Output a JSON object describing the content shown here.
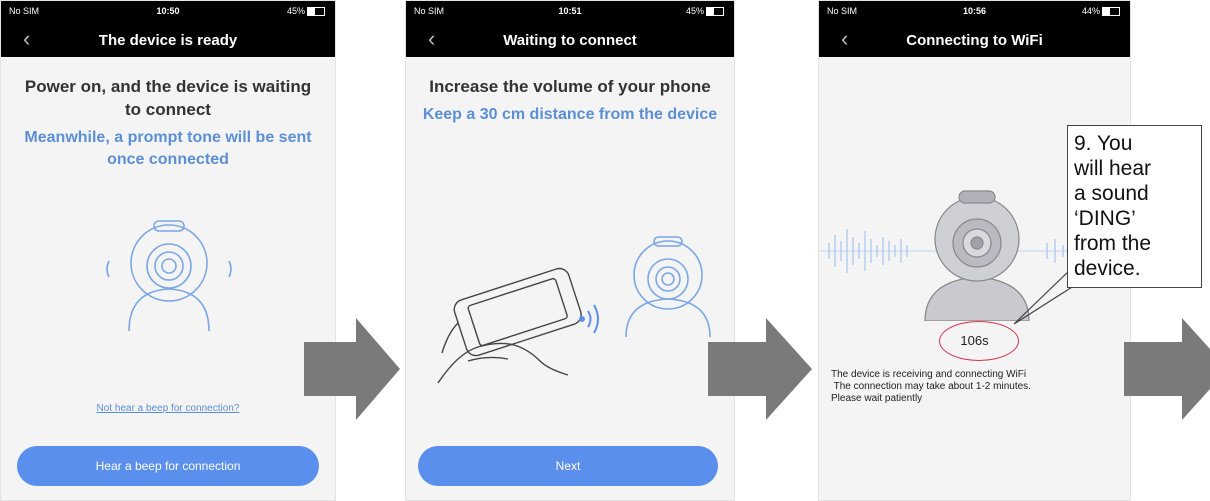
{
  "screens": [
    {
      "status": {
        "carrier": "No SIM",
        "time": "10:50",
        "battery": "45%"
      },
      "back": "‹",
      "title": "The device is ready",
      "heading": "Power on, and the device is waiting to connect",
      "subheading": "Meanwhile, a prompt tone will be sent once connected",
      "help_link": "Not hear a beep for connection?",
      "button": "Hear a beep for connection"
    },
    {
      "status": {
        "carrier": "No SIM",
        "time": "10:51",
        "battery": "45%"
      },
      "back": "‹",
      "title": "Waiting to connect",
      "heading": "Increase the volume of your phone",
      "subheading": "Keep a 30 cm distance from the device",
      "button": "Next"
    },
    {
      "status": {
        "carrier": "No SIM",
        "time": "10:56",
        "battery": "44%"
      },
      "back": "‹",
      "title": "Connecting to WiFi",
      "countdown": "106s",
      "status_lines": [
        "The device is receiving and connecting WiFi",
        " The connection may take about 1-2 minutes.",
        "Please wait patiently"
      ]
    }
  ],
  "callout": {
    "lines": [
      "9. You",
      "will hear",
      "a sound",
      "‘DING’",
      "from the",
      "device."
    ]
  },
  "icons": {
    "camera": "webcam-icon",
    "hand_phone": "hand-holding-phone-icon",
    "sound_wave": "sound-wave-icon",
    "arrow": "right-arrow-icon"
  },
  "colors": {
    "accent": "#5b8fee",
    "subheading": "#5b8fd6",
    "annotation": "#d8334a",
    "arrow": "#7a7a7a"
  }
}
